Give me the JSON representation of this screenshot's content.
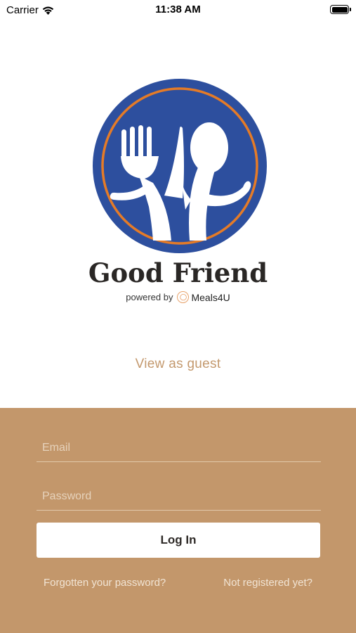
{
  "status_bar": {
    "carrier": "Carrier",
    "time": "11:38 AM",
    "wifi_icon": "wifi-icon",
    "battery_icon": "battery-icon"
  },
  "brand": {
    "name": "Good Friend",
    "powered_by": "powered by",
    "partner_name": "Meals4U",
    "partner_icon": "meals4u-icon",
    "logo_icon": "fork-spoon-logo",
    "colors": {
      "logo_blue": "#2d4f9e",
      "logo_ring": "#e57b27",
      "accent": "#c4996e",
      "panel": "#c3976b"
    }
  },
  "guest_link": "View as guest",
  "login": {
    "email_placeholder": "Email",
    "password_placeholder": "Password",
    "login_label": "Log In",
    "forgot_label": "Forgotten your password?",
    "register_label": "Not registered yet?"
  }
}
